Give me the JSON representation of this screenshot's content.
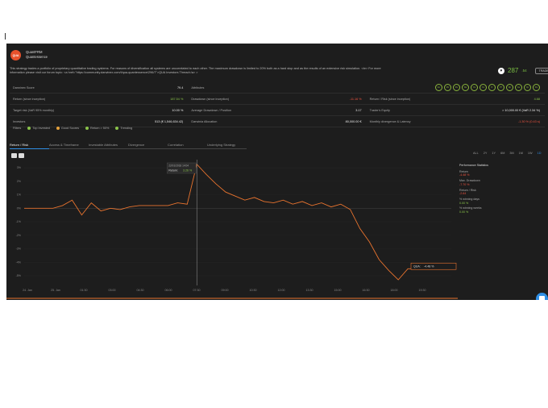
{
  "profile": {
    "avatar_text": "QUA",
    "trader_name": "QuantFRM",
    "strategy_name": "Quantessence",
    "description": "This strategy trades a portfolio of proprietary quantitative trading systems. For reasons of diversification all systems are uncorrelated to each other. The maximum drawdown is limited to 20% both as a hard stop and as the results of an extensive risk simulation. <br> For more information please visit our forum topic: <a href=\"https://community.darwinex.com/t/qua-quantessence/296/7\">QUA Investors Thread</a> >",
    "price_int": "287",
    "price_dec": ".54",
    "trade_label": "TRADE"
  },
  "stats": {
    "rows": [
      [
        {
          "label": "Darwinex Score",
          "value": "79.4"
        },
        {
          "label": "Attributes",
          "value": ""
        },
        {
          "label": "",
          "value": ""
        }
      ],
      [
        {
          "label": "Return (since inception)",
          "value": "187.54 %",
          "tone": "pos"
        },
        {
          "label": "Drawdown (since inception)",
          "value": "-11.16 %",
          "tone": "neg"
        },
        {
          "label": "Return / Risk (since inception)",
          "value": "4.68",
          "tone": "pos"
        }
      ],
      [
        {
          "label": "Target risk (VaR 95% monthly)",
          "value": "10.00 %"
        },
        {
          "label": "Average Drawdown / Position",
          "value": "3.17"
        },
        {
          "label": "Trader's Equity",
          "value": "> 10,000.00 € (VaR 2.34 %)"
        }
      ],
      [
        {
          "label": "Investors",
          "value": "513 (€ 1,546,634.42)"
        },
        {
          "label": "Darwinia Allocation",
          "value": "80,000.00 €"
        },
        {
          "label": "Monthly divergence & Latency",
          "value": "-1.30 % (0.43 s)",
          "tone": "neg"
        }
      ]
    ],
    "attribute_badges": [
      "Ex",
      "Mc",
      "Rs",
      "Ra",
      "Os",
      "Cs",
      "R",
      "Pf",
      "Rp",
      "Ca",
      "Cp",
      "Ds"
    ]
  },
  "filters": {
    "label": "Filters",
    "items": [
      {
        "label": "Top Invested",
        "color": "#8ac34a"
      },
      {
        "label": "Good Scores",
        "color": "#e6a23c"
      },
      {
        "label": "Return > 50%",
        "color": "#8ac34a"
      },
      {
        "label": "Trending",
        "color": "#8ac34a"
      }
    ]
  },
  "tabs": [
    "Return / Risk",
    "Access & Timeframe",
    "Investable Attributes",
    "Divergence",
    "Correlation",
    "Underlying Strategy"
  ],
  "ranges": [
    "ALL",
    "2Y",
    "1Y",
    "6M",
    "3M",
    "1M",
    "1W",
    "1D"
  ],
  "tooltip": {
    "date": "22/01/2018 14:04",
    "label": "Return:",
    "value": "3.26 %"
  },
  "end_label": {
    "name": "QUA:",
    "value": "-4.48 %"
  },
  "performance": {
    "title": "Performance Statistics",
    "items": [
      {
        "label": "Return",
        "value": "-4.48 %",
        "tone": "nv"
      },
      {
        "label": "Max. Drawdown",
        "value": "-7.70 %",
        "tone": "nv"
      },
      {
        "label": "Return / Risk",
        "value": "-2.64",
        "tone": "nv"
      },
      {
        "label": "% winning days",
        "value": "0.00 %",
        "tone": "pv"
      },
      {
        "label": "% winning weeks",
        "value": "0.00 %",
        "tone": "pv"
      }
    ]
  },
  "chart_data": {
    "type": "line",
    "series": [
      {
        "name": "QUA",
        "x": [
          "24. Jan 06:00",
          "06:30",
          "07:00",
          "07:15",
          "07:30",
          "07:35",
          "07:40",
          "07:45",
          "07:50",
          "08:00",
          "08:15",
          "08:30",
          "09:00",
          "10:00",
          "11:00",
          "12:00",
          "13:00",
          "13:10",
          "13:15",
          "13:20",
          "13:25",
          "13:30",
          "13:35",
          "13:40",
          "13:45",
          "13:50",
          "14:00",
          "14:15",
          "14:30",
          "15:00",
          "15:30",
          "16:00",
          "16:30",
          "17:00",
          "17:30",
          "18:00",
          "18:15",
          "18:30",
          "18:45",
          "19:00",
          "19:15",
          "19:30"
        ],
        "values": [
          0,
          0,
          0,
          0,
          0.2,
          0.6,
          -0.5,
          0.4,
          -0.2,
          0,
          -0.1,
          0.1,
          0.2,
          0.2,
          0.2,
          0.2,
          0.4,
          0.3,
          3.26,
          2.5,
          1.8,
          1.2,
          0.9,
          0.6,
          0.8,
          0.5,
          0.4,
          0.6,
          0.3,
          0.5,
          0.2,
          0.4,
          0.1,
          0.3,
          -0.1,
          -1.5,
          -2.5,
          -3.8,
          -4.6,
          -5.3,
          -4.48,
          -4.48
        ]
      }
    ],
    "yticks": [
      "3%",
      "2%",
      "1%",
      "0%",
      "-1%",
      "-2%",
      "-3%",
      "-4%",
      "-5%"
    ],
    "xticks": [
      "24. Jan",
      "25. Jan",
      "01:30",
      "03:00",
      "04:30",
      "06:00",
      "07:30",
      "09:00",
      "10:30",
      "12:00",
      "13:30",
      "15:00",
      "16:30",
      "18:00",
      "19:30"
    ],
    "ylim": [
      -5.6,
      3.6
    ]
  }
}
